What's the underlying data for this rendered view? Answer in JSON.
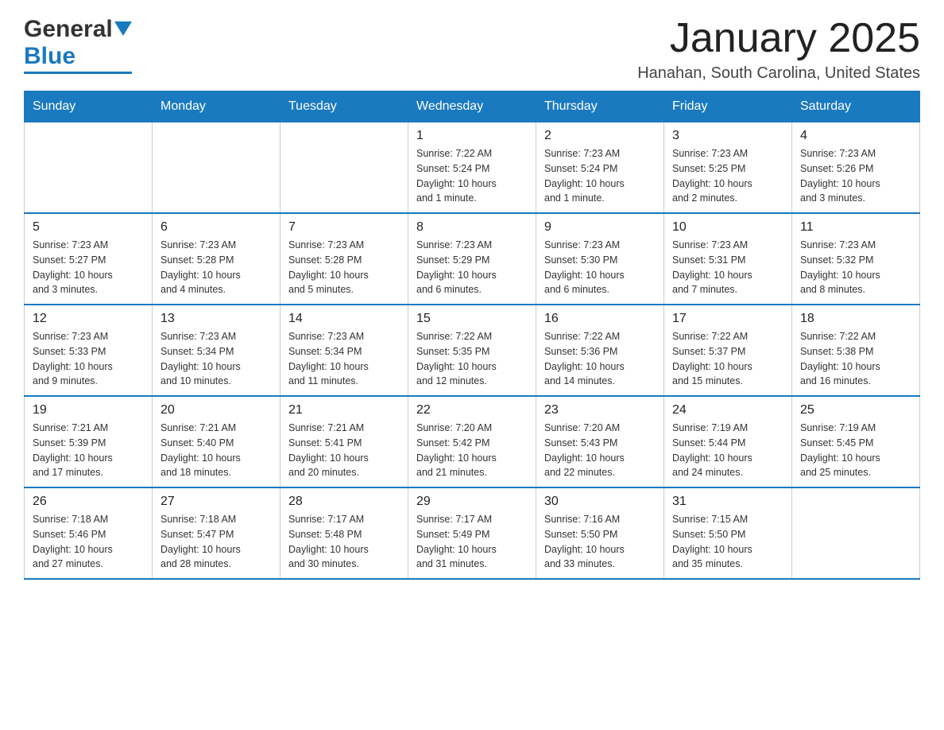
{
  "header": {
    "logo_line1": "General",
    "logo_line2": "Blue",
    "title": "January 2025",
    "subtitle": "Hanahan, South Carolina, United States"
  },
  "days_of_week": [
    "Sunday",
    "Monday",
    "Tuesday",
    "Wednesday",
    "Thursday",
    "Friday",
    "Saturday"
  ],
  "weeks": [
    [
      {
        "day": "",
        "info": ""
      },
      {
        "day": "",
        "info": ""
      },
      {
        "day": "",
        "info": ""
      },
      {
        "day": "1",
        "info": "Sunrise: 7:22 AM\nSunset: 5:24 PM\nDaylight: 10 hours\nand 1 minute."
      },
      {
        "day": "2",
        "info": "Sunrise: 7:23 AM\nSunset: 5:24 PM\nDaylight: 10 hours\nand 1 minute."
      },
      {
        "day": "3",
        "info": "Sunrise: 7:23 AM\nSunset: 5:25 PM\nDaylight: 10 hours\nand 2 minutes."
      },
      {
        "day": "4",
        "info": "Sunrise: 7:23 AM\nSunset: 5:26 PM\nDaylight: 10 hours\nand 3 minutes."
      }
    ],
    [
      {
        "day": "5",
        "info": "Sunrise: 7:23 AM\nSunset: 5:27 PM\nDaylight: 10 hours\nand 3 minutes."
      },
      {
        "day": "6",
        "info": "Sunrise: 7:23 AM\nSunset: 5:28 PM\nDaylight: 10 hours\nand 4 minutes."
      },
      {
        "day": "7",
        "info": "Sunrise: 7:23 AM\nSunset: 5:28 PM\nDaylight: 10 hours\nand 5 minutes."
      },
      {
        "day": "8",
        "info": "Sunrise: 7:23 AM\nSunset: 5:29 PM\nDaylight: 10 hours\nand 6 minutes."
      },
      {
        "day": "9",
        "info": "Sunrise: 7:23 AM\nSunset: 5:30 PM\nDaylight: 10 hours\nand 6 minutes."
      },
      {
        "day": "10",
        "info": "Sunrise: 7:23 AM\nSunset: 5:31 PM\nDaylight: 10 hours\nand 7 minutes."
      },
      {
        "day": "11",
        "info": "Sunrise: 7:23 AM\nSunset: 5:32 PM\nDaylight: 10 hours\nand 8 minutes."
      }
    ],
    [
      {
        "day": "12",
        "info": "Sunrise: 7:23 AM\nSunset: 5:33 PM\nDaylight: 10 hours\nand 9 minutes."
      },
      {
        "day": "13",
        "info": "Sunrise: 7:23 AM\nSunset: 5:34 PM\nDaylight: 10 hours\nand 10 minutes."
      },
      {
        "day": "14",
        "info": "Sunrise: 7:23 AM\nSunset: 5:34 PM\nDaylight: 10 hours\nand 11 minutes."
      },
      {
        "day": "15",
        "info": "Sunrise: 7:22 AM\nSunset: 5:35 PM\nDaylight: 10 hours\nand 12 minutes."
      },
      {
        "day": "16",
        "info": "Sunrise: 7:22 AM\nSunset: 5:36 PM\nDaylight: 10 hours\nand 14 minutes."
      },
      {
        "day": "17",
        "info": "Sunrise: 7:22 AM\nSunset: 5:37 PM\nDaylight: 10 hours\nand 15 minutes."
      },
      {
        "day": "18",
        "info": "Sunrise: 7:22 AM\nSunset: 5:38 PM\nDaylight: 10 hours\nand 16 minutes."
      }
    ],
    [
      {
        "day": "19",
        "info": "Sunrise: 7:21 AM\nSunset: 5:39 PM\nDaylight: 10 hours\nand 17 minutes."
      },
      {
        "day": "20",
        "info": "Sunrise: 7:21 AM\nSunset: 5:40 PM\nDaylight: 10 hours\nand 18 minutes."
      },
      {
        "day": "21",
        "info": "Sunrise: 7:21 AM\nSunset: 5:41 PM\nDaylight: 10 hours\nand 20 minutes."
      },
      {
        "day": "22",
        "info": "Sunrise: 7:20 AM\nSunset: 5:42 PM\nDaylight: 10 hours\nand 21 minutes."
      },
      {
        "day": "23",
        "info": "Sunrise: 7:20 AM\nSunset: 5:43 PM\nDaylight: 10 hours\nand 22 minutes."
      },
      {
        "day": "24",
        "info": "Sunrise: 7:19 AM\nSunset: 5:44 PM\nDaylight: 10 hours\nand 24 minutes."
      },
      {
        "day": "25",
        "info": "Sunrise: 7:19 AM\nSunset: 5:45 PM\nDaylight: 10 hours\nand 25 minutes."
      }
    ],
    [
      {
        "day": "26",
        "info": "Sunrise: 7:18 AM\nSunset: 5:46 PM\nDaylight: 10 hours\nand 27 minutes."
      },
      {
        "day": "27",
        "info": "Sunrise: 7:18 AM\nSunset: 5:47 PM\nDaylight: 10 hours\nand 28 minutes."
      },
      {
        "day": "28",
        "info": "Sunrise: 7:17 AM\nSunset: 5:48 PM\nDaylight: 10 hours\nand 30 minutes."
      },
      {
        "day": "29",
        "info": "Sunrise: 7:17 AM\nSunset: 5:49 PM\nDaylight: 10 hours\nand 31 minutes."
      },
      {
        "day": "30",
        "info": "Sunrise: 7:16 AM\nSunset: 5:50 PM\nDaylight: 10 hours\nand 33 minutes."
      },
      {
        "day": "31",
        "info": "Sunrise: 7:15 AM\nSunset: 5:50 PM\nDaylight: 10 hours\nand 35 minutes."
      },
      {
        "day": "",
        "info": ""
      }
    ]
  ]
}
